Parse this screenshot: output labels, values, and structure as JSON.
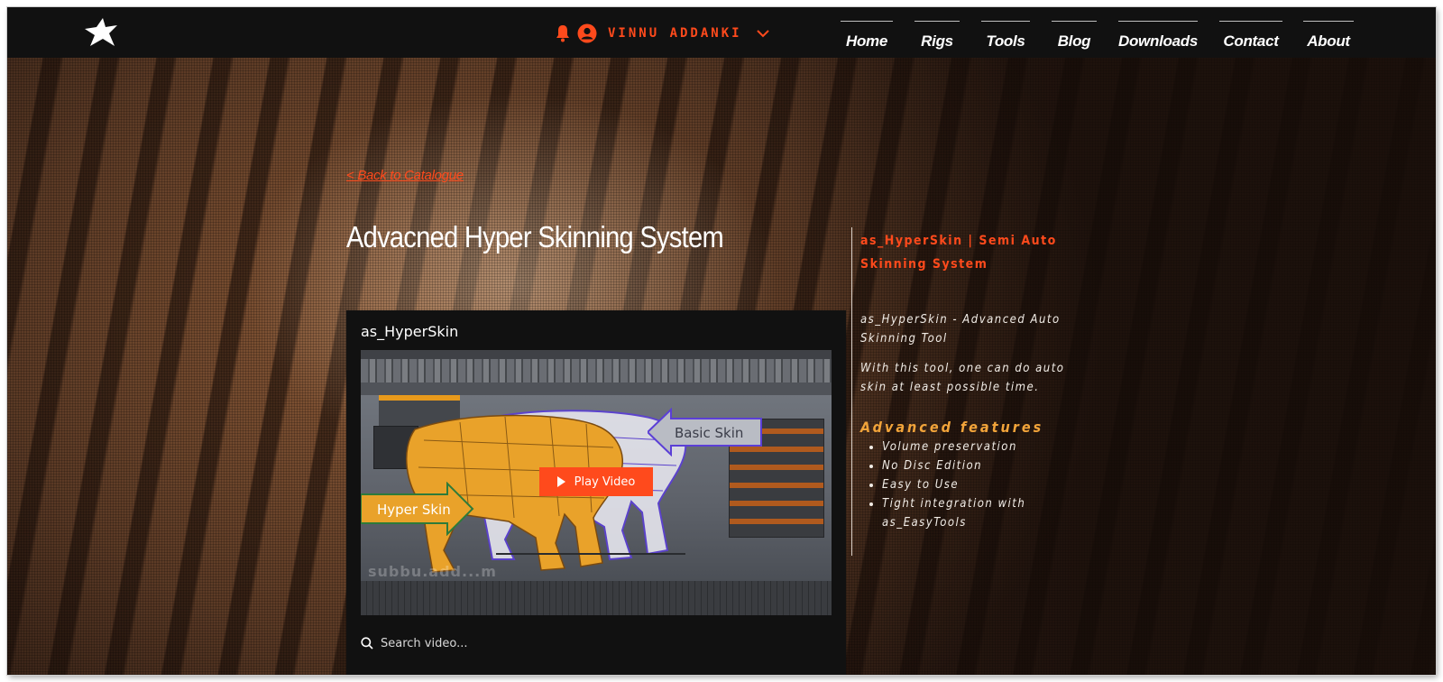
{
  "header": {
    "user_name": "VINNU ADDANKI",
    "nav": [
      "Home",
      "Rigs",
      "Tools",
      "Blog",
      "Downloads",
      "Contact",
      "About"
    ]
  },
  "content": {
    "back_link": "< Back to Catalogue",
    "title": "Advacned Hyper Skinning System"
  },
  "video": {
    "title": "as_HyperSkin",
    "play_label": "Play Video",
    "basic_label": "Basic Skin",
    "hyper_label": "Hyper Skin",
    "watermark": "subbu.add...m",
    "search_placeholder": "Search video..."
  },
  "side": {
    "heading": "as_HyperSkin  |  Semi Auto Skinning System",
    "p1": "as_HyperSkin - Advanced Auto Skinning Tool",
    "p2": "With this tool, one can do auto skin at least possible time.",
    "features_title": "Advanced features",
    "features": [
      "Volume preservation",
      "No Disc Edition",
      "Easy to Use",
      "Tight integration with as_EasyTools"
    ]
  },
  "colors": {
    "accent": "#ff4a1c",
    "features_title": "#f2a43a",
    "header_bg": "#111111"
  },
  "icons": [
    "star-logo-icon",
    "bell-icon",
    "user-avatar-icon",
    "chevron-down-icon",
    "play-icon",
    "search-icon"
  ]
}
